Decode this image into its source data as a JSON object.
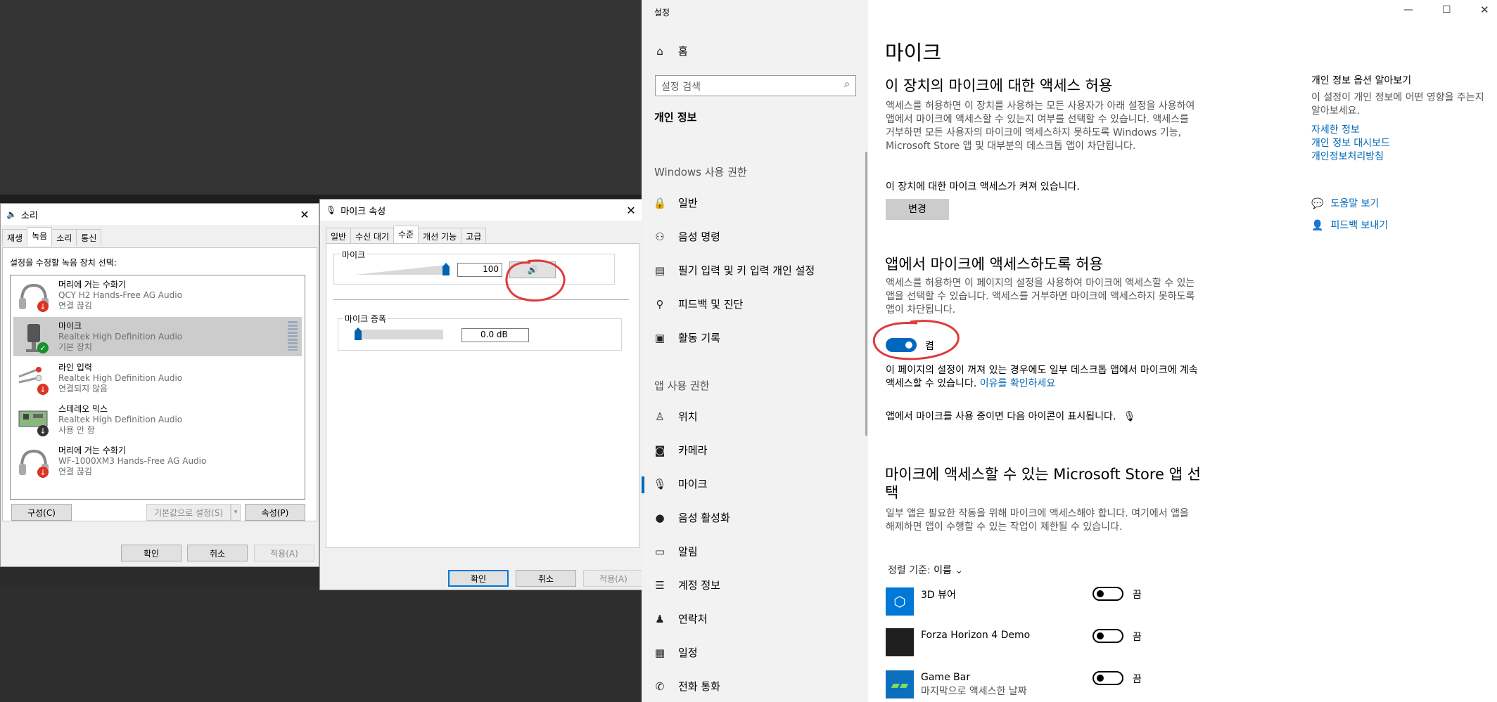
{
  "sound_dialog": {
    "title": "소리",
    "tabs": [
      "재생",
      "녹음",
      "소리",
      "통신"
    ],
    "active_tab": 1,
    "instruction": "설정을 수정할 녹음 장치 선택:",
    "devices": [
      {
        "name": "머리에 거는 수화기",
        "sub": "QCY H2 Hands-Free AG Audio",
        "status": "연결 끊김",
        "icon": "headset-icon",
        "badge": "down-arrow",
        "selected": false
      },
      {
        "name": "마이크",
        "sub": "Realtek High Definition Audio",
        "status": "기본 장치",
        "icon": "microphone-icon",
        "badge": "check",
        "selected": true
      },
      {
        "name": "라인 입력",
        "sub": "Realtek High Definition Audio",
        "status": "연결되지 않음",
        "icon": "line-in-icon",
        "badge": "down-arrow",
        "selected": false
      },
      {
        "name": "스테레오 믹스",
        "sub": "Realtek High Definition Audio",
        "status": "사용 안 함",
        "icon": "sound-card-icon",
        "badge": "down-arrow-black",
        "selected": false
      },
      {
        "name": "머리에 거는 수화기",
        "sub": "WF-1000XM3 Hands-Free AG Audio",
        "status": "연결 끊김",
        "icon": "headset-icon",
        "badge": "down-arrow",
        "selected": false
      }
    ],
    "btn_configure": "구성(C)",
    "btn_default": "기본값으로 설정(S)",
    "btn_properties": "속성(P)",
    "btn_ok": "확인",
    "btn_cancel": "취소",
    "btn_apply": "적용(A)"
  },
  "mic_props": {
    "title": "마이크 속성",
    "tabs": [
      "일반",
      "수신 대기",
      "수준",
      "개선 기능",
      "고급"
    ],
    "active_tab": 2,
    "mic_group": "마이크",
    "mic_value": "100",
    "mic_level": 1.0,
    "boost_group": "마이크 증폭",
    "boost_value": "0.0 dB",
    "boost_level": 0.0,
    "btn_ok": "확인",
    "btn_cancel": "취소",
    "btn_apply": "적용(A)"
  },
  "settings": {
    "window_title": "설정",
    "nav": {
      "home": "홈",
      "search_placeholder": "설정 검색",
      "category": "개인 정보",
      "windows_perm_header": "Windows 사용 권한",
      "windows_items": [
        {
          "label": "일반",
          "icon": "lock-icon"
        },
        {
          "label": "음성 명령",
          "icon": "speech-icon"
        },
        {
          "label": "필기 입력 및 키 입력 개인 설정",
          "icon": "clipboard-icon"
        },
        {
          "label": "피드백 및 진단",
          "icon": "feedback-icon"
        },
        {
          "label": "활동 기록",
          "icon": "timeline-icon"
        }
      ],
      "app_perm_header": "앱 사용 권한",
      "app_items": [
        {
          "label": "위치",
          "icon": "location-icon"
        },
        {
          "label": "카메라",
          "icon": "camera-icon"
        },
        {
          "label": "마이크",
          "icon": "microphone-icon"
        },
        {
          "label": "음성 활성화",
          "icon": "voice-activation-icon"
        },
        {
          "label": "알림",
          "icon": "notification-icon"
        },
        {
          "label": "계정 정보",
          "icon": "account-info-icon"
        },
        {
          "label": "연락처",
          "icon": "contacts-icon"
        },
        {
          "label": "일정",
          "icon": "calendar-icon"
        },
        {
          "label": "전화 통화",
          "icon": "phone-icon"
        }
      ]
    },
    "main": {
      "title": "마이크",
      "device_heading": "이 장치의 마이크에 대한 액세스 허용",
      "device_desc": "액세스를 허용하면 이 장치를 사용하는 모든 사용자가 아래 설정을 사용하여 앱에서 마이크에 액세스할 수 있는지 여부를 선택할 수 있습니다. 액세스를 거부하면 모든 사용자의 마이크에 액세스하지 못하도록 Windows 기능, Microsoft Store 앱 및 대부분의 데스크톱 앱이 차단됩니다.",
      "device_status": "이 장치에 대한 마이크 액세스가 켜져 있습니다.",
      "change_btn": "변경",
      "apps_heading": "앱에서 마이크에 액세스하도록 허용",
      "apps_desc": "액세스를 허용하면 이 페이지의 설정을 사용하여 마이크에 액세스할 수 있는 앱을 선택할 수 있습니다. 액세스를 거부하면 마이크에 액세스하지 못하도록 앱이 차단됩니다.",
      "apps_toggle_label": "켬",
      "apps_toggle_on": true,
      "desktop_note": "이 페이지의 설정이 꺼져 있는 경우에도 일부 데스크톱 앱에서 마이크에 계속 액세스할 수 있습니다.",
      "desktop_link": "이유를 확인하세요",
      "icon_note": "앱에서 마이크를 사용 중이면 다음 아이콘이 표시됩니다.",
      "store_heading": "마이크에 액세스할 수 있는 Microsoft Store 앱 선택",
      "store_desc": "일부 앱은 필요한 작동을 위해 마이크에 액세스해야 합니다. 여기에서 앱을 해제하면 앱이 수행할 수 있는 작업이 제한될 수 있습니다.",
      "sort_label": "정렬 기준:",
      "sort_value": "이름",
      "apps": [
        {
          "name": "3D 뷰어",
          "sub": "",
          "state": "끔",
          "on": false,
          "icon": "3d-viewer-icon",
          "color": "#0078d7"
        },
        {
          "name": "Forza Horizon 4 Demo",
          "sub": "",
          "state": "끔",
          "on": false,
          "icon": "forza-icon",
          "color": "#1f1f1f"
        },
        {
          "name": "Game Bar",
          "sub": "마지막으로 액세스한 날짜",
          "state": "끔",
          "on": false,
          "icon": "game-bar-icon",
          "color": "#0b6fbd"
        }
      ]
    },
    "side": {
      "heading": "개인 정보 옵션 알아보기",
      "desc": "이 설정이 개인 정보에 어떤 영향을 주는지 알아보세요.",
      "links": [
        "자세한 정보",
        "개인 정보 대시보드",
        "개인정보처리방침"
      ],
      "help": "도움말 보기",
      "feedback": "피드백 보내기"
    }
  }
}
